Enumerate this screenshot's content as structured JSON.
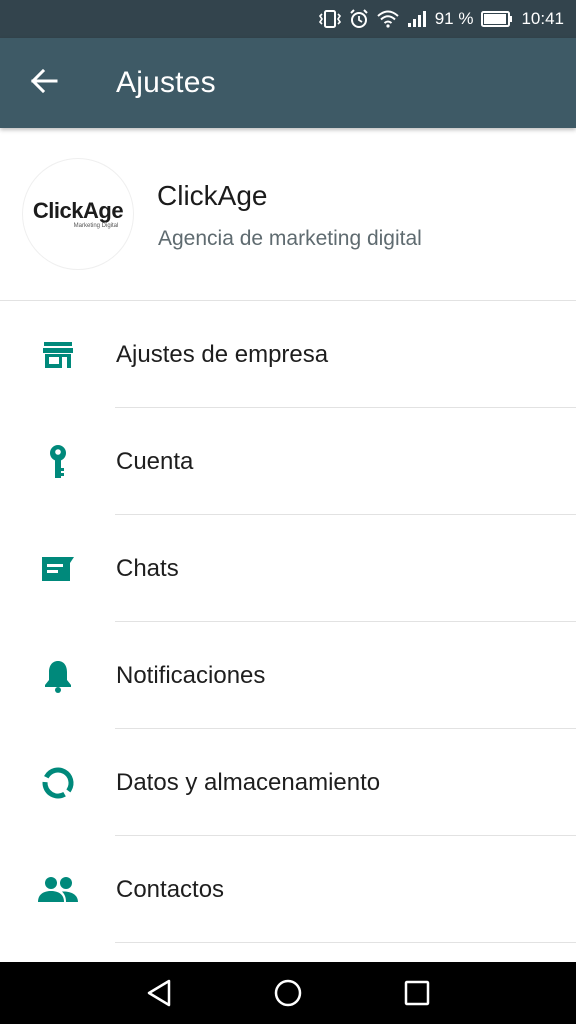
{
  "status_bar": {
    "battery_percent": "91 %",
    "time": "10:41",
    "icons": [
      "vibrate-icon",
      "alarm-icon",
      "wifi-icon",
      "signal-icon",
      "battery-icon"
    ]
  },
  "app_bar": {
    "title": "Ajustes",
    "back_icon": "arrow-back-icon"
  },
  "profile": {
    "logo_text": "ClickAge",
    "logo_subtext": "Marketing Digital",
    "name": "ClickAge",
    "status": "Agencia de marketing digital"
  },
  "menu": {
    "items": [
      {
        "label": "Ajustes de empresa",
        "icon": "store-icon"
      },
      {
        "label": "Cuenta",
        "icon": "key-icon"
      },
      {
        "label": "Chats",
        "icon": "chat-icon"
      },
      {
        "label": "Notificaciones",
        "icon": "bell-icon"
      },
      {
        "label": "Datos y almacenamiento",
        "icon": "data-usage-icon"
      },
      {
        "label": "Contactos",
        "icon": "contacts-icon"
      }
    ]
  },
  "nav_bar": {
    "icons": [
      "back-triangle-icon",
      "home-circle-icon",
      "recents-square-icon"
    ]
  },
  "colors": {
    "status_bar": "#33444d",
    "app_bar": "#3e5a66",
    "accent": "#00897b"
  }
}
